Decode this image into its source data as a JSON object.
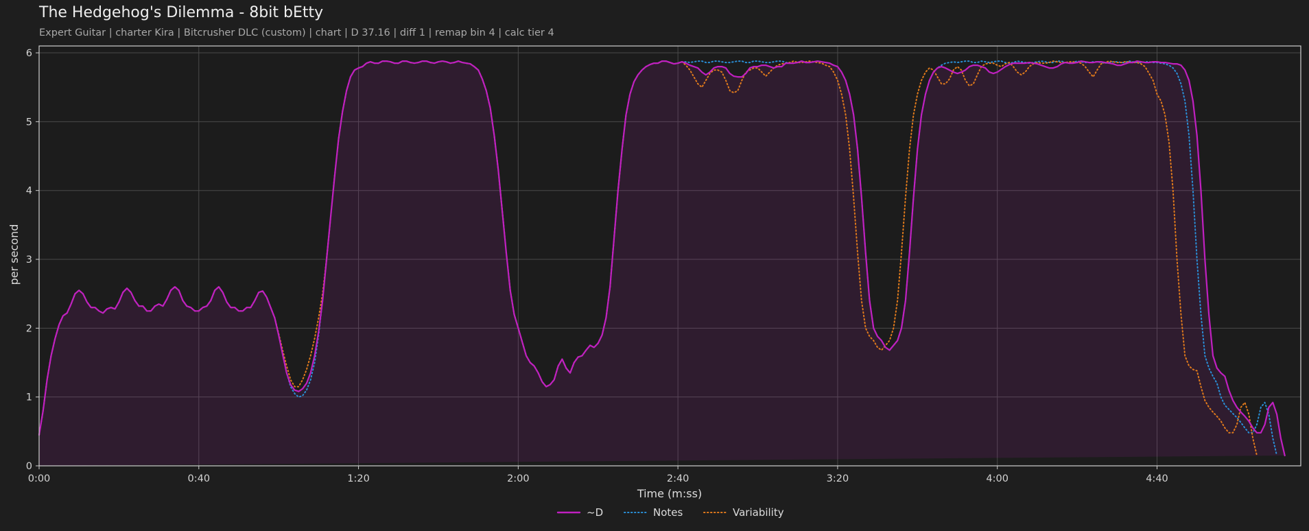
{
  "page": {
    "title": "The Hedgehog's Dilemma - 8bit bEtty",
    "subtitle": "Expert Guitar  |  charter Kira  |  Bitcrusher DLC (custom)  |  chart  |  D 37.16  |  diff 1  |  remap bin 4  |  calc tier 4"
  },
  "chart_data": {
    "type": "line",
    "title": "The Hedgehog's Dilemma - 8bit bEtty",
    "xlabel": "Time (m:ss)",
    "ylabel": "per second",
    "xlim": [
      0,
      316
    ],
    "ylim": [
      0,
      6.1
    ],
    "x_ticks": [
      0,
      40,
      80,
      120,
      160,
      200,
      240,
      280
    ],
    "x_tick_labels": [
      "0:00",
      "0:40",
      "1:20",
      "2:00",
      "2:40",
      "3:20",
      "4:00",
      "4:40"
    ],
    "y_ticks": [
      0,
      1,
      2,
      3,
      4,
      5,
      6
    ],
    "y_tick_labels": [
      "0",
      "1",
      "2",
      "3",
      "4",
      "5",
      "6"
    ],
    "grid": true,
    "legend_position": "bottom-center",
    "x": [
      0,
      1,
      2,
      3,
      4,
      5,
      6,
      7,
      8,
      9,
      10,
      11,
      12,
      13,
      14,
      15,
      16,
      17,
      18,
      19,
      20,
      21,
      22,
      23,
      24,
      25,
      26,
      27,
      28,
      29,
      30,
      31,
      32,
      33,
      34,
      35,
      36,
      37,
      38,
      39,
      40,
      41,
      42,
      43,
      44,
      45,
      46,
      47,
      48,
      49,
      50,
      51,
      52,
      53,
      54,
      55,
      56,
      57,
      58,
      59,
      60,
      61,
      62,
      63,
      64,
      65,
      66,
      67,
      68,
      69,
      70,
      71,
      72,
      73,
      74,
      75,
      76,
      77,
      78,
      79,
      80,
      81,
      82,
      83,
      84,
      85,
      86,
      87,
      88,
      89,
      90,
      91,
      92,
      93,
      94,
      95,
      96,
      97,
      98,
      99,
      100,
      101,
      102,
      103,
      104,
      105,
      106,
      107,
      108,
      109,
      110,
      111,
      112,
      113,
      114,
      115,
      116,
      117,
      118,
      119,
      120,
      121,
      122,
      123,
      124,
      125,
      126,
      127,
      128,
      129,
      130,
      131,
      132,
      133,
      134,
      135,
      136,
      137,
      138,
      139,
      140,
      141,
      142,
      143,
      144,
      145,
      146,
      147,
      148,
      149,
      150,
      151,
      152,
      153,
      154,
      155,
      156,
      157,
      158,
      159,
      160,
      161,
      162,
      163,
      164,
      165,
      166,
      167,
      168,
      169,
      170,
      171,
      172,
      173,
      174,
      175,
      176,
      177,
      178,
      179,
      180,
      181,
      182,
      183,
      184,
      185,
      186,
      187,
      188,
      189,
      190,
      191,
      192,
      193,
      194,
      195,
      196,
      197,
      198,
      199,
      200,
      201,
      202,
      203,
      204,
      205,
      206,
      207,
      208,
      209,
      210,
      211,
      212,
      213,
      214,
      215,
      216,
      217,
      218,
      219,
      220,
      221,
      222,
      223,
      224,
      225,
      226,
      227,
      228,
      229,
      230,
      231,
      232,
      233,
      234,
      235,
      236,
      237,
      238,
      239,
      240,
      241,
      242,
      243,
      244,
      245,
      246,
      247,
      248,
      249,
      250,
      251,
      252,
      253,
      254,
      255,
      256,
      257,
      258,
      259,
      260,
      261,
      262,
      263,
      264,
      265,
      266,
      267,
      268,
      269,
      270,
      271,
      272,
      273,
      274,
      275,
      276,
      277,
      278,
      279,
      280,
      281,
      282,
      283,
      284,
      285,
      286,
      287,
      288,
      289,
      290,
      291,
      292,
      293,
      294,
      295,
      296,
      297,
      298,
      299,
      300,
      301,
      302,
      303,
      304,
      305,
      306,
      307,
      308,
      309,
      310,
      311,
      312,
      313,
      314,
      315,
      316
    ],
    "series": [
      {
        "name": "~D",
        "color": "#c020c0",
        "style": "solid",
        "values": [
          0.45,
          0.8,
          1.25,
          1.6,
          1.85,
          2.05,
          2.18,
          2.22,
          2.35,
          2.5,
          2.55,
          2.5,
          2.38,
          2.3,
          2.3,
          2.25,
          2.22,
          2.28,
          2.3,
          2.28,
          2.38,
          2.52,
          2.58,
          2.52,
          2.4,
          2.32,
          2.32,
          2.25,
          2.25,
          2.32,
          2.35,
          2.32,
          2.42,
          2.55,
          2.6,
          2.55,
          2.4,
          2.32,
          2.3,
          2.25,
          2.25,
          2.3,
          2.32,
          2.4,
          2.55,
          2.6,
          2.52,
          2.38,
          2.3,
          2.3,
          2.25,
          2.25,
          2.3,
          2.3,
          2.4,
          2.52,
          2.54,
          2.45,
          2.3,
          2.15,
          1.9,
          1.62,
          1.35,
          1.18,
          1.1,
          1.08,
          1.12,
          1.2,
          1.35,
          1.6,
          1.95,
          2.4,
          3.0,
          3.6,
          4.2,
          4.75,
          5.15,
          5.45,
          5.65,
          5.75,
          5.78,
          5.8,
          5.85,
          5.87,
          5.85,
          5.85,
          5.88,
          5.88,
          5.87,
          5.85,
          5.85,
          5.88,
          5.88,
          5.86,
          5.85,
          5.86,
          5.88,
          5.88,
          5.86,
          5.85,
          5.87,
          5.88,
          5.87,
          5.85,
          5.86,
          5.88,
          5.86,
          5.85,
          5.84,
          5.8,
          5.75,
          5.62,
          5.45,
          5.2,
          4.8,
          4.3,
          3.7,
          3.1,
          2.55,
          2.2,
          2.0,
          1.8,
          1.6,
          1.5,
          1.45,
          1.35,
          1.22,
          1.15,
          1.18,
          1.25,
          1.45,
          1.55,
          1.42,
          1.35,
          1.5,
          1.58,
          1.6,
          1.68,
          1.75,
          1.72,
          1.78,
          1.9,
          2.15,
          2.6,
          3.3,
          4.0,
          4.6,
          5.1,
          5.4,
          5.58,
          5.68,
          5.75,
          5.8,
          5.83,
          5.85,
          5.85,
          5.88,
          5.88,
          5.86,
          5.84,
          5.85,
          5.87,
          5.85,
          5.82,
          5.8,
          5.78,
          5.72,
          5.68,
          5.72,
          5.78,
          5.8,
          5.8,
          5.78,
          5.7,
          5.66,
          5.65,
          5.65,
          5.7,
          5.78,
          5.8,
          5.8,
          5.82,
          5.82,
          5.8,
          5.78,
          5.8,
          5.8,
          5.85,
          5.85,
          5.85,
          5.86,
          5.88,
          5.86,
          5.86,
          5.87,
          5.88,
          5.87,
          5.86,
          5.85,
          5.82,
          5.8,
          5.72,
          5.6,
          5.4,
          5.1,
          4.6,
          3.9,
          3.1,
          2.4,
          2.0,
          1.88,
          1.82,
          1.72,
          1.68,
          1.75,
          1.82,
          2.0,
          2.4,
          3.1,
          3.9,
          4.6,
          5.1,
          5.4,
          5.6,
          5.72,
          5.78,
          5.8,
          5.78,
          5.75,
          5.72,
          5.7,
          5.72,
          5.75,
          5.8,
          5.82,
          5.82,
          5.8,
          5.78,
          5.72,
          5.7,
          5.72,
          5.76,
          5.8,
          5.83,
          5.85,
          5.85,
          5.85,
          5.85,
          5.86,
          5.85,
          5.84,
          5.82,
          5.8,
          5.78,
          5.78,
          5.8,
          5.84,
          5.86,
          5.85,
          5.85,
          5.86,
          5.88,
          5.87,
          5.86,
          5.86,
          5.87,
          5.87,
          5.86,
          5.85,
          5.84,
          5.82,
          5.82,
          5.84,
          5.86,
          5.86,
          5.88,
          5.87,
          5.86,
          5.86,
          5.87,
          5.87,
          5.86,
          5.86,
          5.85,
          5.84,
          5.84,
          5.82,
          5.75,
          5.6,
          5.3,
          4.8,
          4.0,
          3.0,
          2.2,
          1.6,
          1.42,
          1.35,
          1.3,
          1.1,
          0.95,
          0.85,
          0.78,
          0.72,
          0.65,
          0.55,
          0.48,
          0.48,
          0.6,
          0.85,
          0.92,
          0.75,
          0.4,
          0.15
        ]
      },
      {
        "name": "Notes",
        "color": "#2a8fd6",
        "style": "dotted",
        "values": [
          0.45,
          0.8,
          1.25,
          1.6,
          1.85,
          2.05,
          2.18,
          2.22,
          2.35,
          2.5,
          2.55,
          2.5,
          2.38,
          2.3,
          2.3,
          2.25,
          2.22,
          2.28,
          2.3,
          2.28,
          2.38,
          2.52,
          2.58,
          2.52,
          2.4,
          2.32,
          2.32,
          2.25,
          2.25,
          2.32,
          2.35,
          2.32,
          2.42,
          2.55,
          2.6,
          2.55,
          2.4,
          2.32,
          2.3,
          2.25,
          2.25,
          2.3,
          2.32,
          2.4,
          2.55,
          2.6,
          2.52,
          2.38,
          2.3,
          2.3,
          2.25,
          2.25,
          2.3,
          2.3,
          2.4,
          2.52,
          2.54,
          2.45,
          2.3,
          2.15,
          1.9,
          1.62,
          1.35,
          1.15,
          1.05,
          1.0,
          1.02,
          1.1,
          1.25,
          1.5,
          1.9,
          2.4,
          3.0,
          3.6,
          4.2,
          4.75,
          5.15,
          5.45,
          5.65,
          5.75,
          5.78,
          5.8,
          5.85,
          5.87,
          5.85,
          5.85,
          5.88,
          5.88,
          5.87,
          5.85,
          5.85,
          5.88,
          5.88,
          5.86,
          5.85,
          5.86,
          5.88,
          5.88,
          5.86,
          5.85,
          5.87,
          5.88,
          5.87,
          5.85,
          5.86,
          5.88,
          5.86,
          5.85,
          5.84,
          5.8,
          5.75,
          5.62,
          5.45,
          5.2,
          4.8,
          4.3,
          3.7,
          3.1,
          2.55,
          2.2,
          2.0,
          1.8,
          1.6,
          1.5,
          1.45,
          1.35,
          1.22,
          1.15,
          1.18,
          1.25,
          1.45,
          1.55,
          1.42,
          1.35,
          1.5,
          1.58,
          1.6,
          1.68,
          1.75,
          1.72,
          1.78,
          1.9,
          2.15,
          2.6,
          3.3,
          4.0,
          4.6,
          5.1,
          5.4,
          5.58,
          5.68,
          5.75,
          5.8,
          5.83,
          5.85,
          5.85,
          5.88,
          5.88,
          5.86,
          5.84,
          5.85,
          5.87,
          5.87,
          5.86,
          5.87,
          5.88,
          5.88,
          5.86,
          5.86,
          5.88,
          5.88,
          5.87,
          5.86,
          5.86,
          5.87,
          5.88,
          5.88,
          5.86,
          5.86,
          5.88,
          5.88,
          5.87,
          5.86,
          5.86,
          5.87,
          5.88,
          5.88,
          5.86,
          5.85,
          5.85,
          5.86,
          5.88,
          5.86,
          5.86,
          5.87,
          5.88,
          5.87,
          5.86,
          5.85,
          5.82,
          5.8,
          5.72,
          5.6,
          5.4,
          5.1,
          4.6,
          3.9,
          3.1,
          2.4,
          2.0,
          1.88,
          1.82,
          1.72,
          1.68,
          1.75,
          1.82,
          2.0,
          2.4,
          3.1,
          3.9,
          4.6,
          5.1,
          5.4,
          5.6,
          5.72,
          5.78,
          5.82,
          5.85,
          5.86,
          5.87,
          5.86,
          5.87,
          5.88,
          5.88,
          5.86,
          5.86,
          5.88,
          5.87,
          5.86,
          5.87,
          5.88,
          5.88,
          5.86,
          5.85,
          5.86,
          5.88,
          5.87,
          5.86,
          5.85,
          5.86,
          5.87,
          5.88,
          5.87,
          5.86,
          5.86,
          5.88,
          5.88,
          5.86,
          5.85,
          5.86,
          5.88,
          5.87,
          5.86,
          5.86,
          5.87,
          5.87,
          5.86,
          5.85,
          5.86,
          5.87,
          5.87,
          5.86,
          5.86,
          5.88,
          5.87,
          5.86,
          5.86,
          5.87,
          5.87,
          5.86,
          5.86,
          5.85,
          5.84,
          5.82,
          5.78,
          5.7,
          5.55,
          5.3,
          4.8,
          4.0,
          3.0,
          2.2,
          1.6,
          1.42,
          1.3,
          1.2,
          1.0,
          0.88,
          0.82,
          0.76,
          0.7,
          0.63,
          0.55,
          0.48,
          0.48,
          0.6,
          0.85,
          0.92,
          0.75,
          0.4,
          0.15
        ]
      },
      {
        "name": "Variability",
        "color": "#e07a1c",
        "style": "dotted",
        "values": [
          0.45,
          0.8,
          1.25,
          1.6,
          1.85,
          2.05,
          2.18,
          2.22,
          2.35,
          2.5,
          2.55,
          2.5,
          2.38,
          2.3,
          2.3,
          2.25,
          2.22,
          2.28,
          2.3,
          2.28,
          2.38,
          2.52,
          2.58,
          2.52,
          2.4,
          2.32,
          2.32,
          2.25,
          2.25,
          2.32,
          2.35,
          2.32,
          2.42,
          2.55,
          2.6,
          2.55,
          2.4,
          2.32,
          2.3,
          2.25,
          2.25,
          2.3,
          2.32,
          2.4,
          2.55,
          2.6,
          2.52,
          2.38,
          2.3,
          2.3,
          2.25,
          2.25,
          2.3,
          2.3,
          2.4,
          2.52,
          2.54,
          2.45,
          2.3,
          2.15,
          1.92,
          1.68,
          1.45,
          1.25,
          1.15,
          1.15,
          1.25,
          1.4,
          1.6,
          1.85,
          2.15,
          2.5,
          3.0,
          3.6,
          4.2,
          4.75,
          5.15,
          5.45,
          5.65,
          5.75,
          5.78,
          5.8,
          5.85,
          5.87,
          5.85,
          5.85,
          5.88,
          5.88,
          5.87,
          5.85,
          5.85,
          5.88,
          5.88,
          5.86,
          5.85,
          5.86,
          5.88,
          5.88,
          5.86,
          5.85,
          5.87,
          5.88,
          5.87,
          5.85,
          5.86,
          5.88,
          5.86,
          5.85,
          5.84,
          5.8,
          5.75,
          5.62,
          5.45,
          5.2,
          4.8,
          4.3,
          3.7,
          3.1,
          2.55,
          2.2,
          2.0,
          1.8,
          1.6,
          1.5,
          1.45,
          1.35,
          1.22,
          1.15,
          1.18,
          1.25,
          1.45,
          1.55,
          1.42,
          1.35,
          1.5,
          1.58,
          1.6,
          1.68,
          1.75,
          1.72,
          1.78,
          1.9,
          2.15,
          2.6,
          3.3,
          4.0,
          4.6,
          5.1,
          5.4,
          5.58,
          5.68,
          5.75,
          5.8,
          5.83,
          5.85,
          5.85,
          5.88,
          5.88,
          5.86,
          5.84,
          5.85,
          5.87,
          5.82,
          5.75,
          5.65,
          5.55,
          5.5,
          5.6,
          5.7,
          5.75,
          5.75,
          5.72,
          5.6,
          5.45,
          5.42,
          5.45,
          5.6,
          5.72,
          5.75,
          5.78,
          5.78,
          5.72,
          5.66,
          5.72,
          5.78,
          5.82,
          5.84,
          5.85,
          5.86,
          5.88,
          5.86,
          5.86,
          5.87,
          5.88,
          5.87,
          5.86,
          5.85,
          5.82,
          5.8,
          5.72,
          5.6,
          5.4,
          5.1,
          4.6,
          3.9,
          3.1,
          2.4,
          2.0,
          1.88,
          1.82,
          1.72,
          1.68,
          1.75,
          1.82,
          2.0,
          2.4,
          3.1,
          3.9,
          4.6,
          5.1,
          5.4,
          5.6,
          5.72,
          5.78,
          5.75,
          5.65,
          5.55,
          5.55,
          5.62,
          5.75,
          5.8,
          5.75,
          5.6,
          5.52,
          5.55,
          5.68,
          5.8,
          5.84,
          5.85,
          5.85,
          5.82,
          5.8,
          5.84,
          5.86,
          5.8,
          5.72,
          5.68,
          5.72,
          5.8,
          5.84,
          5.86,
          5.85,
          5.85,
          5.86,
          5.88,
          5.87,
          5.86,
          5.86,
          5.87,
          5.87,
          5.86,
          5.85,
          5.8,
          5.72,
          5.65,
          5.75,
          5.84,
          5.86,
          5.88,
          5.87,
          5.86,
          5.86,
          5.87,
          5.87,
          5.86,
          5.86,
          5.84,
          5.8,
          5.7,
          5.6,
          5.4,
          5.3,
          5.1,
          4.7,
          4.0,
          3.0,
          2.2,
          1.6,
          1.45,
          1.4,
          1.38,
          1.15,
          0.95,
          0.85,
          0.78,
          0.72,
          0.65,
          0.55,
          0.48,
          0.48,
          0.6,
          0.85,
          0.92,
          0.75,
          0.4,
          0.15
        ]
      }
    ]
  }
}
